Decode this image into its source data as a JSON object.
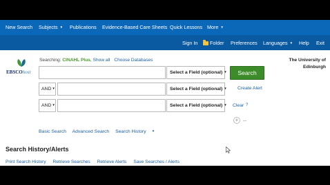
{
  "nav_primary": {
    "items": [
      "New Search",
      "Subjects",
      "Publications",
      "Evidence-Based Care Sheets",
      "Quick Lessons",
      "More"
    ]
  },
  "nav_secondary": {
    "items": [
      "Sign In",
      "Folder",
      "Preferences",
      "Languages",
      "Help",
      "Exit"
    ]
  },
  "logo": {
    "brand": "EBSCO",
    "suffix": "host"
  },
  "searching": {
    "label": "Searching:",
    "database": "CINAHL Plus",
    "show_all": "Show all",
    "choose_databases": "Choose Databases"
  },
  "search_rows": [
    {
      "boolean": "",
      "value": "",
      "field": "Select a Field (optional)"
    },
    {
      "boolean": "AND",
      "value": "",
      "field": "Select a Field (optional)"
    },
    {
      "boolean": "AND",
      "value": "",
      "field": "Select a Field (optional)"
    }
  ],
  "actions": {
    "search": "Search",
    "create_alert": "Create Alert",
    "clear": "Clear",
    "help": "?",
    "add_row": "+",
    "remove_row": "–"
  },
  "institution": "The University of Edinburgh",
  "search_options": [
    "Basic Search",
    "Advanced Search",
    "Search History"
  ],
  "history": {
    "title": "Search History/Alerts",
    "links": [
      "Print Search History",
      "Retrieve Searches",
      "Retrieve Alerts",
      "Save Searches / Alerts"
    ]
  },
  "colors": {
    "nav_primary_bg": "#0b67b8",
    "nav_secondary_bg": "#0a5aa1",
    "search_button": "#3d8c2a",
    "database_name": "#4a9a2b",
    "link": "#1a5fa8"
  }
}
